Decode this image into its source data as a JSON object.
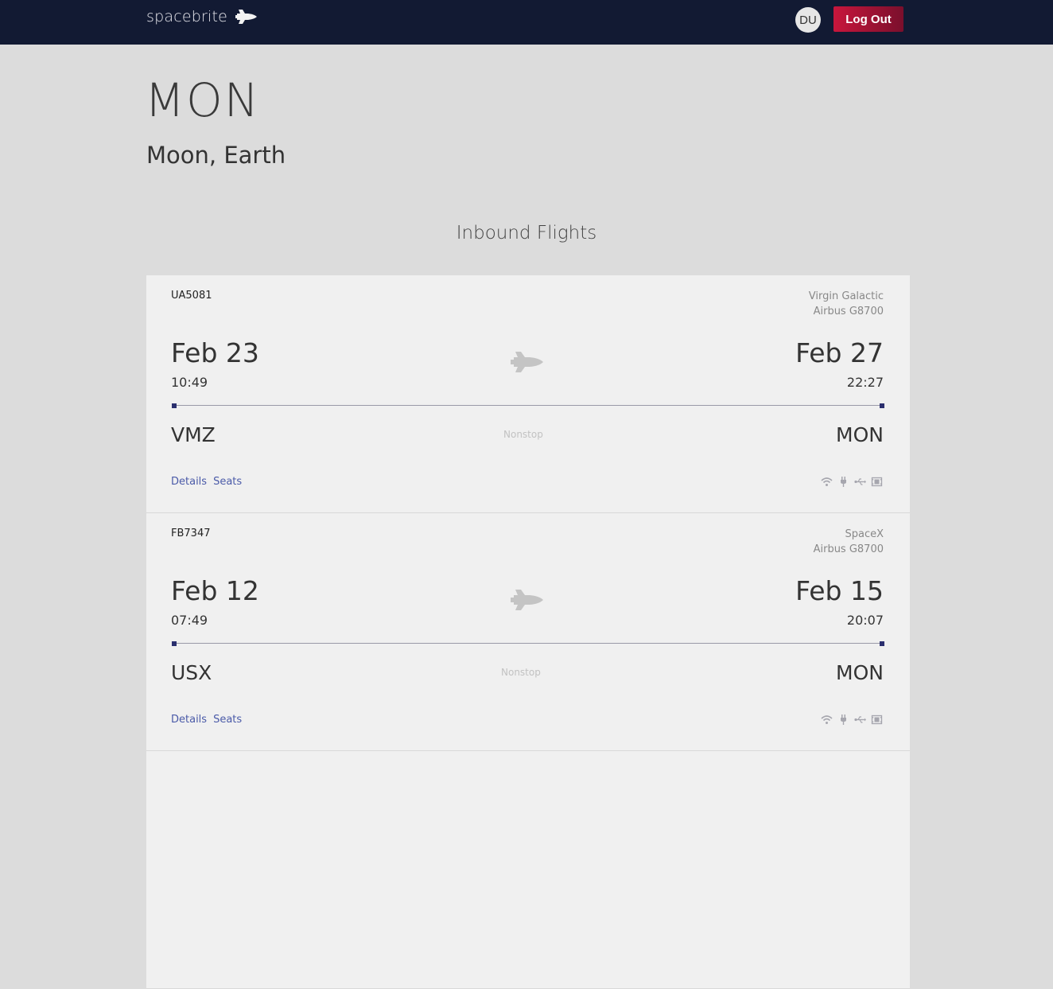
{
  "header": {
    "brand": "spacebrite",
    "brand_icon": "space-shuttle-icon",
    "avatar_initials": "DU",
    "logout_label": "Log Out"
  },
  "page": {
    "code": "MON",
    "place": "Moon, Earth",
    "section_title": "Inbound Flights"
  },
  "flights": [
    {
      "flight_number": "UA5081",
      "operator": "Virgin Galactic",
      "aircraft": "Airbus G8700",
      "dep_date": "Feb 23",
      "dep_time": "10:49",
      "arr_date": "Feb 27",
      "arr_time": "22:27",
      "origin": "VMZ",
      "destination": "MON",
      "stops": "Nonstop",
      "details_label": "Details",
      "seats_label": "Seats",
      "amenities": [
        "wifi-icon",
        "power-plug-icon",
        "usb-icon",
        "film-icon"
      ]
    },
    {
      "flight_number": "FB7347",
      "operator": "SpaceX",
      "aircraft": "Airbus G8700",
      "dep_date": "Feb 12",
      "dep_time": "07:49",
      "arr_date": "Feb 15",
      "arr_time": "20:07",
      "origin": "USX",
      "destination": "MON",
      "stops": "Nonstop",
      "details_label": "Details",
      "seats_label": "Seats",
      "amenities": [
        "wifi-icon",
        "power-plug-icon",
        "usb-icon",
        "film-icon"
      ]
    }
  ],
  "colors": {
    "topbar": "#121a33",
    "logout": "#c8163c",
    "link": "#4a5aa8",
    "track_dot": "#2b2f6e"
  }
}
